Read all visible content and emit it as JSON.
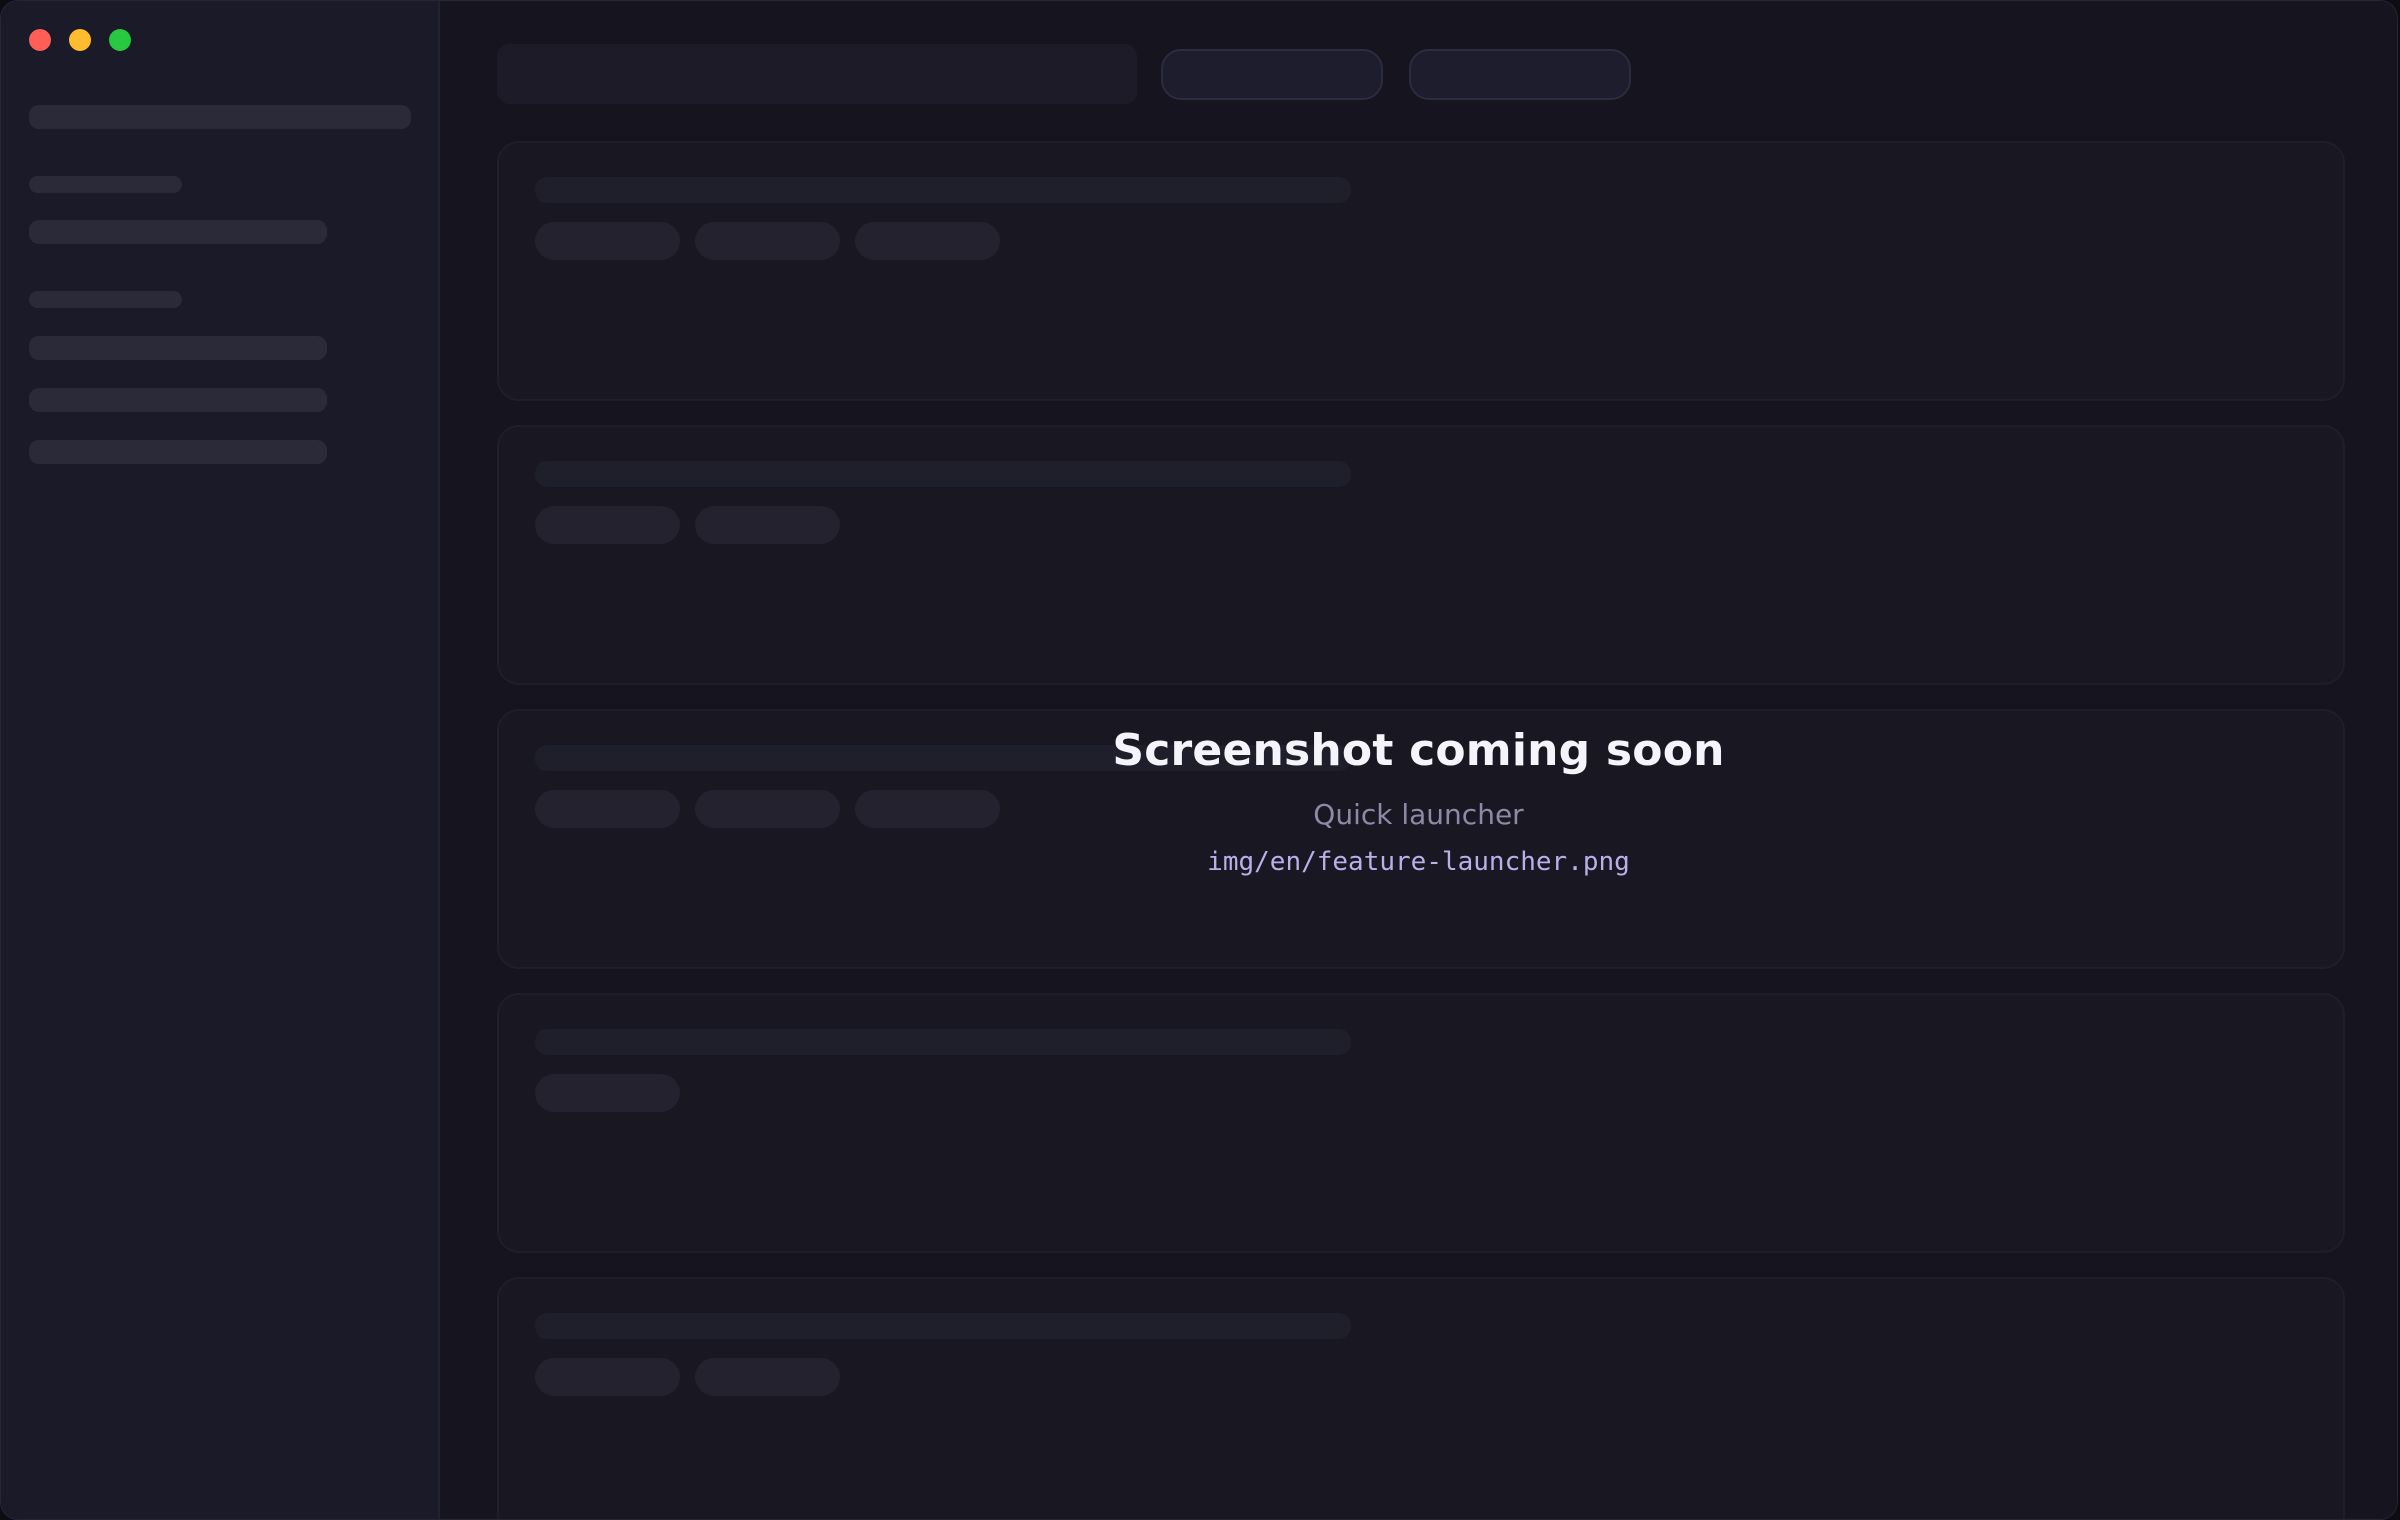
{
  "window": {
    "traffic_lights": {
      "close": "#ff5f57",
      "minimize": "#febc2e",
      "zoom": "#28c840"
    }
  },
  "placeholder": {
    "title": "Screenshot coming soon",
    "subtitle": "Quick launcher",
    "path": "img/en/feature-launcher.png"
  },
  "colors": {
    "window_bg": "#14141f",
    "sidebar_bg": "#1a1a28",
    "accent_path": "#b9b0ea"
  }
}
